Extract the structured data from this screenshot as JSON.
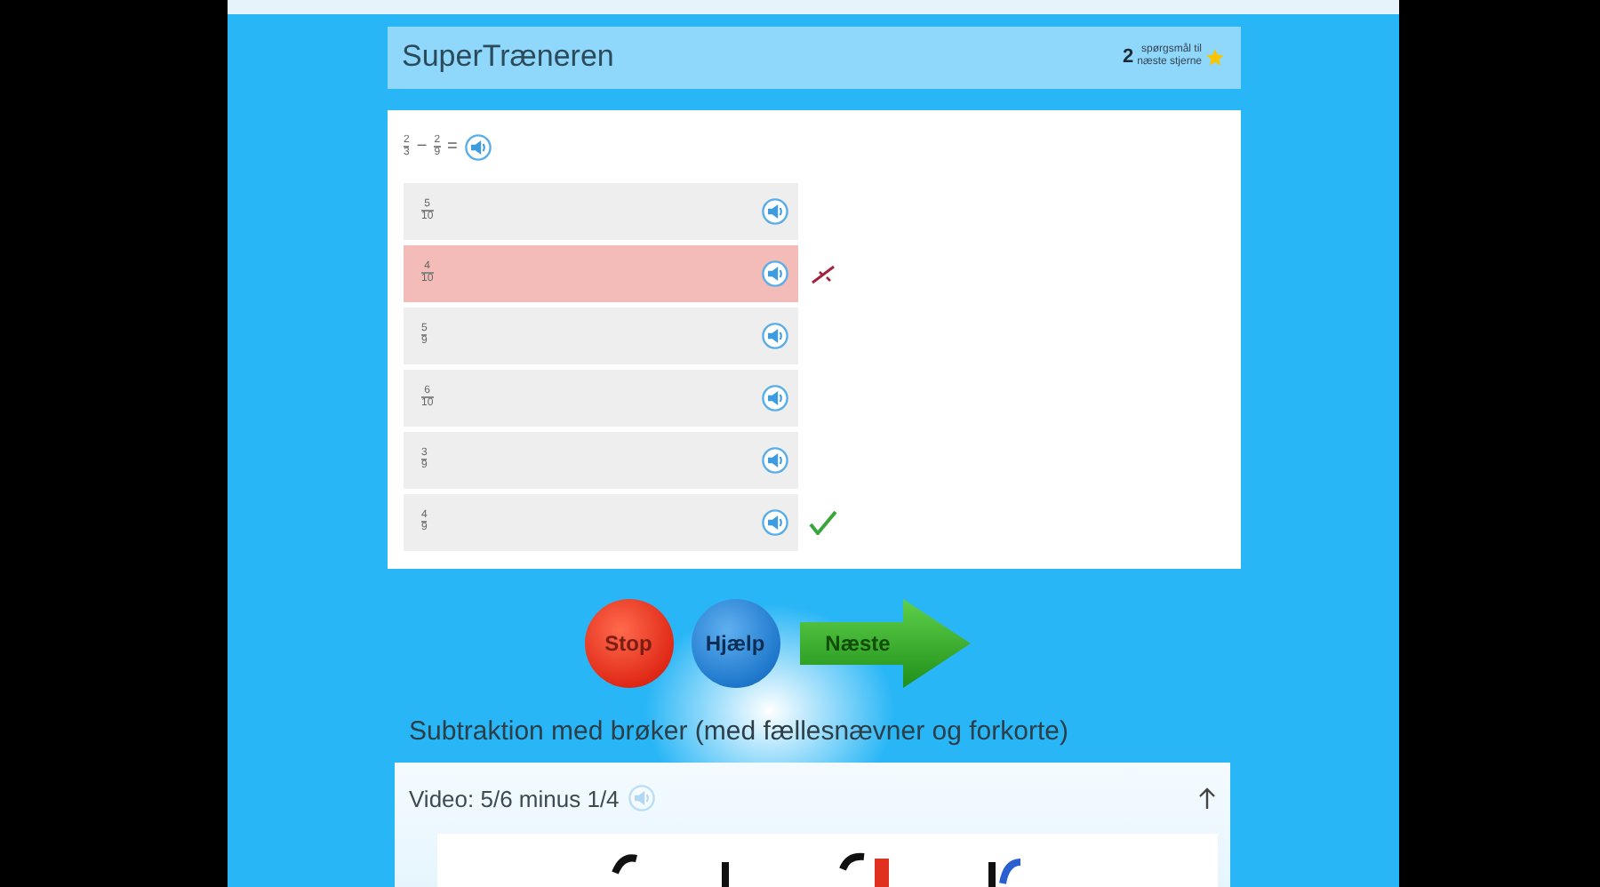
{
  "header": {
    "title": "SuperTræneren",
    "count": "2",
    "count_text_1": "spørgsmål til",
    "count_text_2": "næste stjerne"
  },
  "question": {
    "left": {
      "numerator": "2",
      "denominator": "3"
    },
    "operator": "−",
    "right": {
      "numerator": "2",
      "denominator": "9"
    },
    "equals": "="
  },
  "options": [
    {
      "numerator": "5",
      "denominator": "10",
      "kind": "plain",
      "selected": false
    },
    {
      "numerator": "4",
      "denominator": "10",
      "kind": "wrong",
      "selected": true
    },
    {
      "numerator": "5",
      "denominator": "9",
      "kind": "plain",
      "selected": false
    },
    {
      "numerator": "6",
      "denominator": "10",
      "kind": "plain",
      "selected": false
    },
    {
      "numerator": "3",
      "denominator": "9",
      "kind": "plain",
      "selected": false
    },
    {
      "numerator": "4",
      "denominator": "9",
      "kind": "correct",
      "selected": false
    }
  ],
  "buttons": {
    "stop": "Stop",
    "help": "Hjælp",
    "next": "Næste"
  },
  "section_title": "Subtraktion med brøker (med fællesnævner og forkorte)",
  "video": {
    "title": "Video: 5/6 minus 1/4",
    "kind": "picture"
  }
}
